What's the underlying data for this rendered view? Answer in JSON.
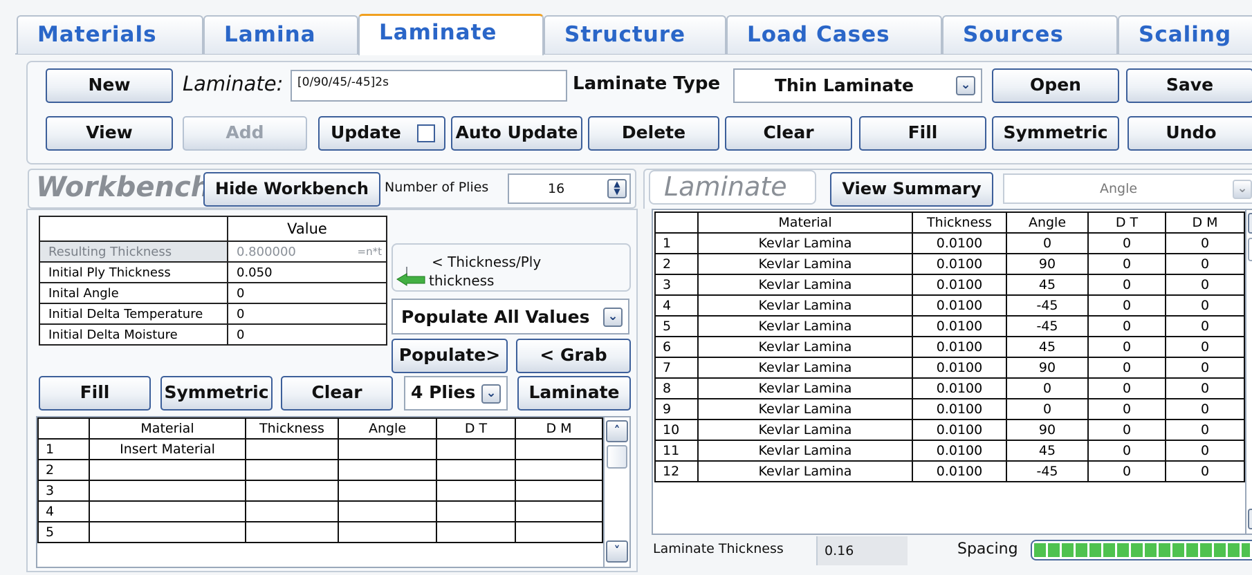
{
  "tabs": [
    "Materials",
    "Lamina",
    "Laminate",
    "Structure",
    "Load Cases",
    "Sources",
    "Scaling"
  ],
  "active_tab": "Laminate",
  "toolbar": {
    "new_label": "New",
    "laminate_label": "Laminate:",
    "laminate_value": "[0/90/45/-45]2s",
    "laminate_type_label": "Laminate Type",
    "laminate_type_value": "Thin Laminate",
    "open_label": "Open",
    "save_label": "Save",
    "view_label": "View",
    "add_label": "Add",
    "update_label": "Update",
    "auto_update_label": "Auto Update",
    "delete_label": "Delete",
    "clear_label": "Clear",
    "fill_label": "Fill",
    "symmetric_label": "Symmetric",
    "undo_label": "Undo"
  },
  "workbench": {
    "title": "Workbench",
    "hide_label": "Hide Workbench",
    "num_plies_label": "Number of Plies",
    "num_plies_value": "16",
    "props_header": "Value",
    "props": [
      {
        "name": "Resulting Thickness",
        "value": "0.800000",
        "formula": "=n*t"
      },
      {
        "name": "Initial Ply Thickness",
        "value": "0.050",
        "formula": ""
      },
      {
        "name": "Inital Angle",
        "value": "0",
        "formula": ""
      },
      {
        "name": "Initial Delta Temperature",
        "value": "0",
        "formula": ""
      },
      {
        "name": "Initial Delta Moisture",
        "value": "0",
        "formula": ""
      }
    ],
    "hint_line1": "< Thickness/Ply",
    "hint_line2": "thickness",
    "populate_all_label": "Populate All Values",
    "populate_label": "Populate>",
    "grab_label": "< Grab",
    "fill_label": "Fill",
    "symmetric_label": "Symmetric",
    "clear_label": "Clear",
    "plies_combo_value": "4 Plies",
    "laminate_btn_label": "Laminate >",
    "columns": [
      "Material",
      "Thickness",
      "Angle",
      "D T",
      "D M"
    ],
    "rows": [
      {
        "n": "1",
        "material": "Insert Material"
      },
      {
        "n": "2",
        "material": ""
      },
      {
        "n": "3",
        "material": ""
      },
      {
        "n": "4",
        "material": ""
      },
      {
        "n": "5",
        "material": ""
      }
    ]
  },
  "laminate_panel": {
    "title": "Laminate",
    "view_summary_label": "View Summary",
    "sort_value": "Angle",
    "columns": [
      "Material",
      "Thickness",
      "Angle",
      "D T",
      "D M"
    ],
    "rows": [
      {
        "n": "1",
        "material": "Kevlar Lamina",
        "thickness": "0.0100",
        "angle": "0",
        "dt": "0",
        "dm": "0"
      },
      {
        "n": "2",
        "material": "Kevlar Lamina",
        "thickness": "0.0100",
        "angle": "90",
        "dt": "0",
        "dm": "0"
      },
      {
        "n": "3",
        "material": "Kevlar Lamina",
        "thickness": "0.0100",
        "angle": "45",
        "dt": "0",
        "dm": "0"
      },
      {
        "n": "4",
        "material": "Kevlar Lamina",
        "thickness": "0.0100",
        "angle": "-45",
        "dt": "0",
        "dm": "0"
      },
      {
        "n": "5",
        "material": "Kevlar Lamina",
        "thickness": "0.0100",
        "angle": "-45",
        "dt": "0",
        "dm": "0"
      },
      {
        "n": "6",
        "material": "Kevlar Lamina",
        "thickness": "0.0100",
        "angle": "45",
        "dt": "0",
        "dm": "0"
      },
      {
        "n": "7",
        "material": "Kevlar Lamina",
        "thickness": "0.0100",
        "angle": "90",
        "dt": "0",
        "dm": "0"
      },
      {
        "n": "8",
        "material": "Kevlar Lamina",
        "thickness": "0.0100",
        "angle": "0",
        "dt": "0",
        "dm": "0"
      },
      {
        "n": "9",
        "material": "Kevlar Lamina",
        "thickness": "0.0100",
        "angle": "0",
        "dt": "0",
        "dm": "0"
      },
      {
        "n": "10",
        "material": "Kevlar Lamina",
        "thickness": "0.0100",
        "angle": "90",
        "dt": "0",
        "dm": "0"
      },
      {
        "n": "11",
        "material": "Kevlar Lamina",
        "thickness": "0.0100",
        "angle": "45",
        "dt": "0",
        "dm": "0"
      },
      {
        "n": "12",
        "material": "Kevlar Lamina",
        "thickness": "0.0100",
        "angle": "-45",
        "dt": "0",
        "dm": "0"
      }
    ],
    "thickness_label": "Laminate Thickness",
    "thickness_value": "0.16",
    "spacing_label": "Spacing",
    "spacing_level": 1.0
  },
  "colors": {
    "tab_text": "#2a66c8",
    "active_tab_accent": "#f0a020",
    "button_border": "#3c5f9a",
    "panel_title": "#8a8f96"
  },
  "icons": {
    "combo": "chevron-down-icon",
    "spinner": "spinner-arrows-icon",
    "hint": "arrow-left-icon",
    "scroll_up": "scroll-up-icon",
    "scroll_down": "scroll-down-icon"
  }
}
